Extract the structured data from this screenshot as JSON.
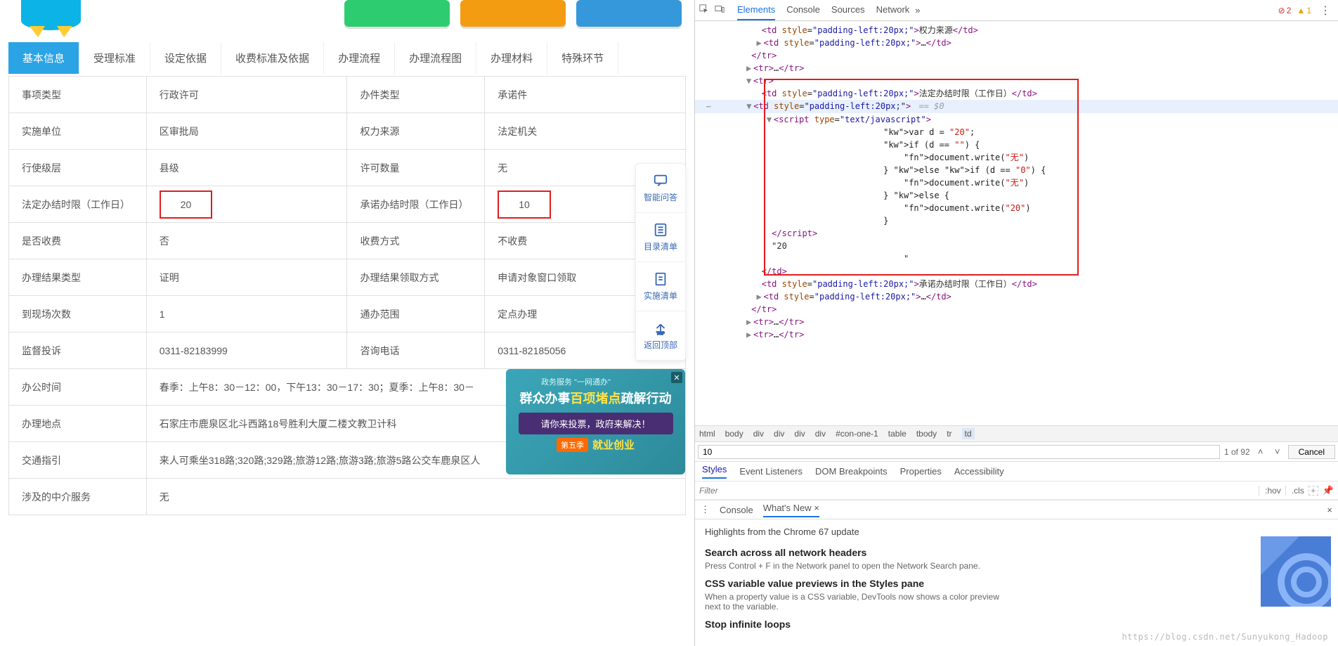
{
  "tabs": [
    "基本信息",
    "受理标准",
    "设定依据",
    "收费标准及依据",
    "办理流程",
    "办理流程图",
    "办理材料",
    "特殊环节"
  ],
  "active_tab": 0,
  "info_rows": [
    {
      "l1": "事项类型",
      "v1": "行政许可",
      "l2": "办件类型",
      "v2": "承诺件"
    },
    {
      "l1": "实施单位",
      "v1": "区审批局",
      "l2": "权力来源",
      "v2": "法定机关"
    },
    {
      "l1": "行使级层",
      "v1": "县级",
      "l2": "许可数量",
      "v2": "无"
    },
    {
      "l1": "法定办结时限（工作日）",
      "v1": "20",
      "v1_boxed": true,
      "l2": "承诺办结时限（工作日）",
      "v2": "10",
      "v2_boxed": true
    },
    {
      "l1": "是否收费",
      "v1": "否",
      "l2": "收费方式",
      "v2": "不收费"
    },
    {
      "l1": "办理结果类型",
      "v1": "证明",
      "l2": "办理结果领取方式",
      "v2": "申请对象窗口领取"
    },
    {
      "l1": "到现场次数",
      "v1": "1",
      "l2": "通办范围",
      "v2": "定点办理"
    },
    {
      "l1": "监督投诉",
      "v1": "0311-82183999",
      "l2": "咨询电话",
      "v2": "0311-82185056"
    }
  ],
  "merged_rows": [
    {
      "label": "办公时间",
      "value": "春季：上午8：30－12：00，下午13：30－17：30；夏季：上午8：30－"
    },
    {
      "label": "办理地点",
      "value": "石家庄市鹿泉区北斗西路18号胜利大厦二楼文教卫计科"
    },
    {
      "label": "交通指引",
      "value": "来人可乘坐318路;320路;329路;旅游12路;旅游3路;旅游5路公交车鹿泉区人"
    },
    {
      "label": "涉及的中介服务",
      "value": "无"
    }
  ],
  "side_float": [
    {
      "label": "智能问答",
      "icon": "chat"
    },
    {
      "label": "目录清单",
      "icon": "list"
    },
    {
      "label": "实施清单",
      "icon": "doc"
    },
    {
      "label": "返回顶部",
      "icon": "top"
    }
  ],
  "banner": {
    "top": "政务服务 \"一网通办\"",
    "main_prefix": "群众办事",
    "main_hl": "百项堵点",
    "main_suffix": "疏解行动",
    "sub": "请你来投票，政府来解决！",
    "tag_badge": "第五季",
    "tag_text": "就业创业",
    "close": "✕"
  },
  "watermark": "https://blog.csdn.net/Sunyukong_Hadoop",
  "devtools": {
    "tabs": [
      "Elements",
      "Console",
      "Sources",
      "Network"
    ],
    "more": "»",
    "errors_label": "2",
    "warnings_label": "1",
    "crumbs": [
      "html",
      "body",
      "div",
      "div",
      "div",
      "div",
      "#con-one-1",
      "table",
      "tbody",
      "tr",
      "td"
    ],
    "find_value": "10",
    "find_count": "1 of 92",
    "cancel": "Cancel",
    "subtabs": [
      "Styles",
      "Event Listeners",
      "DOM Breakpoints",
      "Properties",
      "Accessibility"
    ],
    "filter_placeholder": "Filter",
    "filter_hov": ":hov",
    "filter_cls": ".cls",
    "console_tabs_menu": "⋮",
    "console_tabs": [
      "Console",
      "What's New"
    ],
    "whats_new_close": "×",
    "highlights_title": "Highlights from the Chrome 67 update",
    "hl_items": [
      {
        "h": "Search across all network headers",
        "p": "Press Control + F in the Network panel to open the Network Search pane."
      },
      {
        "h": "CSS variable value previews in the Styles pane",
        "p": "When a property value is a CSS variable, DevTools now shows a color preview next to the variable."
      },
      {
        "h": "Stop infinite loops",
        "p": ""
      }
    ],
    "code": {
      "pad_style": "padding-left:20px;",
      "script_type": "text/javascript",
      "js_lines": [
        "var d = \"20\";",
        "if (d == \"\") {",
        "    document.write(\"无\")",
        "} else if (d == \"0\") {",
        "    document.write(\"无\")",
        "} else {",
        "    document.write(\"20\")",
        "}"
      ],
      "text_after": "\"20",
      "blank_quote": "\"",
      "row_label_legal": "法定办结时限（工作日）",
      "row_label_promise": "承诺办结时限（工作日）",
      "eq0": " == $0",
      "prev_text": "权力来源",
      "ellipsis": "…"
    }
  }
}
